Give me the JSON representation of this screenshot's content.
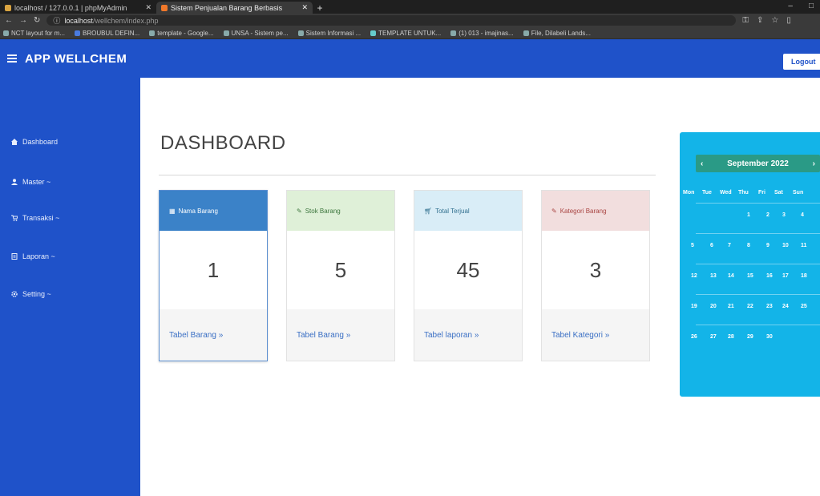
{
  "browser": {
    "tabs": [
      {
        "title": "localhost / 127.0.0.1 | phpMyAdmin",
        "favicon_color": "#d9a441",
        "active": false
      },
      {
        "title": "Sistem Penjualan Barang Berbasis",
        "favicon_color": "#f0782a",
        "active": true
      }
    ],
    "new_tab": "+",
    "url_host": "localhost",
    "url_path": "/wellchem/index.php",
    "window_controls": [
      "–",
      "□",
      "✕"
    ],
    "bookmarks": [
      "NCT layout for m...",
      "BROUBUL DEFIN...",
      "template - Google...",
      "UNSA - Sistem pe...",
      "Sistem Informasi ...",
      "TEMPLATE UNTUK...",
      "(1) 013 - imajinas...",
      "File, Dilabeli Lands..."
    ]
  },
  "app": {
    "brand": "APP WELLCHEM",
    "logout_label": "Logout"
  },
  "sidebar": {
    "items": [
      {
        "label": "Dashboard"
      },
      {
        "label": "Master ~"
      },
      {
        "label": "Transaksi ~"
      },
      {
        "label": "Laporan ~"
      },
      {
        "label": "Setting ~"
      }
    ]
  },
  "main": {
    "title": "DASHBOARD",
    "cards": [
      {
        "header": "Nama Barang",
        "value": "1",
        "link": "Tabel Barang »",
        "style": "primary",
        "icon": "list-icon"
      },
      {
        "header": "Stok Barang",
        "value": "5",
        "link": "Tabel Barang »",
        "style": "success",
        "icon": "pencil-icon"
      },
      {
        "header": "Total Terjual",
        "value": "45",
        "link": "Tabel laporan »",
        "style": "info",
        "icon": "cart-icon"
      },
      {
        "header": "Kategori Barang",
        "value": "3",
        "link": "Tabel Kategori »",
        "style": "danger",
        "icon": "pencil-icon"
      }
    ]
  },
  "calendar": {
    "month_label": "September 2022",
    "prev": "‹",
    "next": "›",
    "days_of_week": [
      "Mon",
      "Tue",
      "Wed",
      "Thu",
      "Fri",
      "Sat",
      "Sun"
    ],
    "weeks": [
      [
        "",
        "",
        "",
        "1",
        "2",
        "3",
        "4"
      ],
      [
        "5",
        "6",
        "7",
        "8",
        "9",
        "10",
        "11"
      ],
      [
        "12",
        "13",
        "14",
        "15",
        "16",
        "17",
        "18"
      ],
      [
        "19",
        "20",
        "21",
        "22",
        "23",
        "24",
        "25"
      ],
      [
        "26",
        "27",
        "28",
        "29",
        "30",
        "",
        ""
      ]
    ]
  },
  "colors": {
    "brand_blue": "#1f52c9",
    "calendar_bg": "#13b4e8",
    "calendar_head": "#2a9a86"
  }
}
